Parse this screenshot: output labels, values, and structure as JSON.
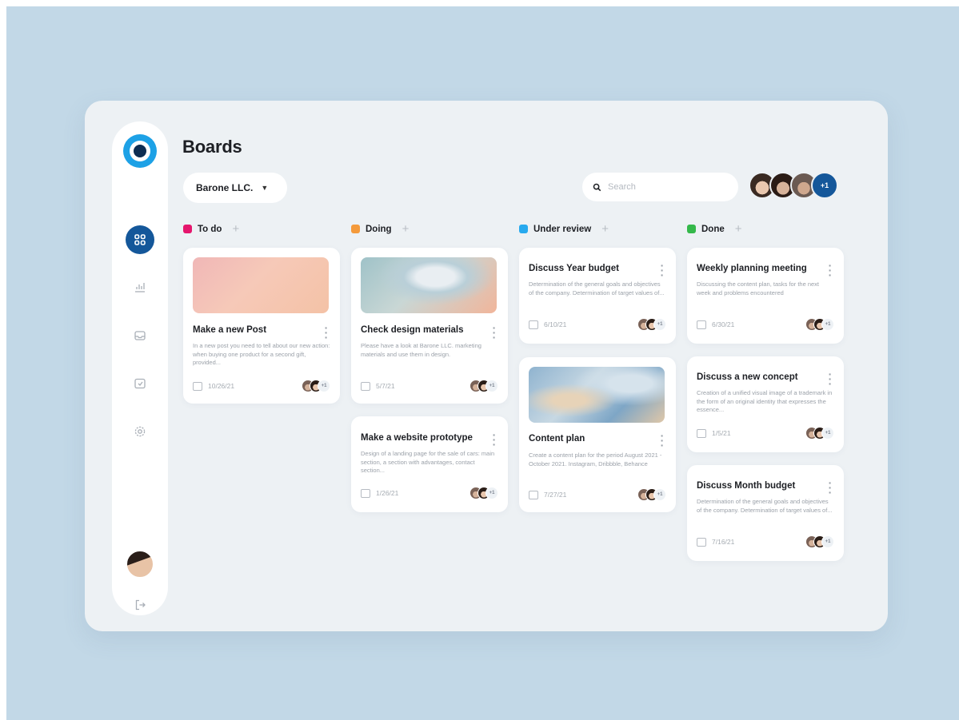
{
  "header": {
    "title": "Boards",
    "org_selected": "Barone LLC.",
    "search_placeholder": "Search",
    "team_more": "+1"
  },
  "sidebar": {
    "items": [
      {
        "icon": "grid-icon",
        "active": true
      },
      {
        "icon": "chart-icon",
        "active": false
      },
      {
        "icon": "inbox-icon",
        "active": false
      },
      {
        "icon": "calendar-icon",
        "active": false
      },
      {
        "icon": "gear-icon",
        "active": false
      }
    ],
    "logout_icon": "logout-icon"
  },
  "colors": {
    "accent": "#14579a",
    "todo": "#e5166d",
    "doing": "#f49a3b",
    "review": "#27a9ee",
    "done": "#34b84a"
  },
  "columns": [
    {
      "name": "To do",
      "cards": [
        {
          "title": "Make a new Post",
          "desc": "In a new post you need to tell about our new action: when buying one product for a second gift, provided...",
          "date": "10/26/21",
          "more": "+1"
        }
      ]
    },
    {
      "name": "Doing",
      "cards": [
        {
          "title": "Check design materials",
          "desc": "Please have a look at Barone LLC. marketing materials and use them in design.",
          "date": "5/7/21",
          "more": "+1"
        },
        {
          "title": "Make a website prototype",
          "desc": "Design of a landing page for the sale of cars: main section, a section with advantages, contact section...",
          "date": "1/26/21",
          "more": "+1"
        }
      ]
    },
    {
      "name": "Under review",
      "cards": [
        {
          "title": "Discuss Year budget",
          "desc": "Determination of the general goals and objectives of the company. Determination of target values of...",
          "date": "6/10/21",
          "more": "+1"
        },
        {
          "title": "Content plan",
          "desc": "Create a content plan for the period August 2021 - October 2021. Instagram, Dribbble, Behance",
          "date": "7/27/21",
          "more": "+1"
        }
      ]
    },
    {
      "name": "Done",
      "cards": [
        {
          "title": "Weekly planning meeting",
          "desc": "Discussing the content plan, tasks for the next week and problems encountered",
          "date": "6/30/21",
          "more": "+1"
        },
        {
          "title": "Discuss a new concept",
          "desc": "Creation of a unified visual image of a trademark in the form of an original identity that expresses the essence...",
          "date": "1/5/21",
          "more": "+1"
        },
        {
          "title": "Discuss Month budget",
          "desc": "Determination of the general goals and objectives of the company. Determination of target values of...",
          "date": "7/16/21",
          "more": "+1"
        }
      ]
    }
  ]
}
